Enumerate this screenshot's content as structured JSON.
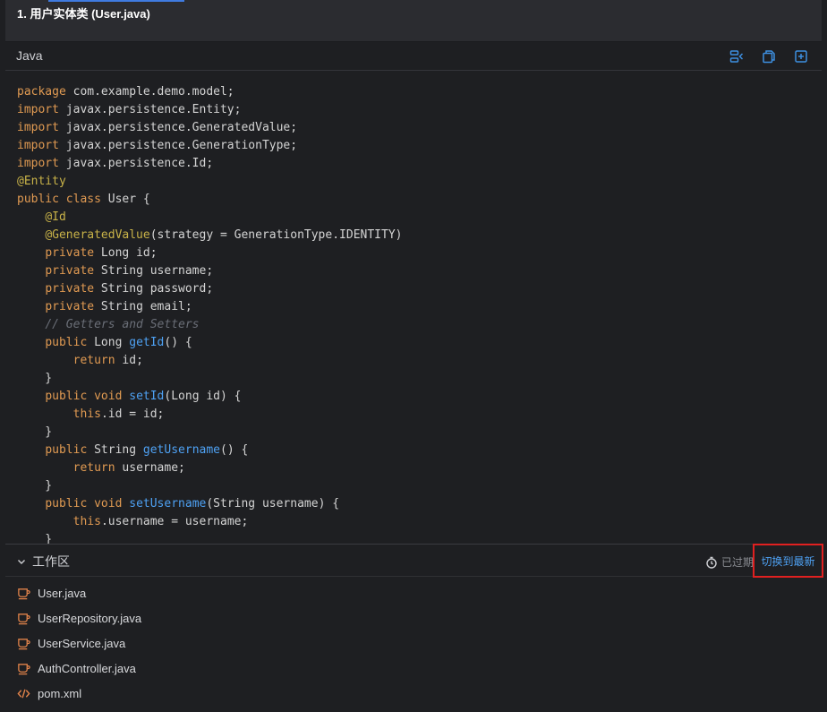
{
  "heading": {
    "text": "1. 用户实体类 (User.java)"
  },
  "code_block": {
    "language": "Java",
    "actions": [
      {
        "icon": "wrap-toggle-icon"
      },
      {
        "icon": "copy-icon"
      },
      {
        "icon": "expand-icon"
      }
    ],
    "lines": [
      [
        {
          "t": "package",
          "c": "kw"
        },
        {
          "t": " com.example.demo.model;"
        }
      ],
      [
        {
          "t": "import",
          "c": "kw"
        },
        {
          "t": " javax.persistence.Entity;"
        }
      ],
      [
        {
          "t": "import",
          "c": "kw"
        },
        {
          "t": " javax.persistence.GeneratedValue;"
        }
      ],
      [
        {
          "t": "import",
          "c": "kw"
        },
        {
          "t": " javax.persistence.GenerationType;"
        }
      ],
      [
        {
          "t": "import",
          "c": "kw"
        },
        {
          "t": " javax.persistence.Id;"
        }
      ],
      [
        {
          "t": "@Entity",
          "c": "an"
        }
      ],
      [
        {
          "t": "public",
          "c": "kw"
        },
        {
          "t": " "
        },
        {
          "t": "class",
          "c": "kw"
        },
        {
          "t": " User {"
        }
      ],
      [
        {
          "t": "    "
        },
        {
          "t": "@Id",
          "c": "an"
        }
      ],
      [
        {
          "t": "    "
        },
        {
          "t": "@GeneratedValue",
          "c": "an"
        },
        {
          "t": "(strategy = GenerationType.IDENTITY)"
        }
      ],
      [
        {
          "t": "    "
        },
        {
          "t": "private",
          "c": "kw"
        },
        {
          "t": " Long id;"
        }
      ],
      [
        {
          "t": "    "
        },
        {
          "t": "private",
          "c": "kw"
        },
        {
          "t": " String username;"
        }
      ],
      [
        {
          "t": "    "
        },
        {
          "t": "private",
          "c": "kw"
        },
        {
          "t": " String password;"
        }
      ],
      [
        {
          "t": "    "
        },
        {
          "t": "private",
          "c": "kw"
        },
        {
          "t": " String email;"
        }
      ],
      [
        {
          "t": "    "
        },
        {
          "t": "// Getters and Setters",
          "c": "cm"
        }
      ],
      [
        {
          "t": "    "
        },
        {
          "t": "public",
          "c": "kw"
        },
        {
          "t": " Long "
        },
        {
          "t": "getId",
          "c": "fn"
        },
        {
          "t": "() {"
        }
      ],
      [
        {
          "t": "        "
        },
        {
          "t": "return",
          "c": "kw"
        },
        {
          "t": " id;"
        }
      ],
      [
        {
          "t": "    }"
        }
      ],
      [
        {
          "t": "    "
        },
        {
          "t": "public",
          "c": "kw"
        },
        {
          "t": " "
        },
        {
          "t": "void",
          "c": "kw"
        },
        {
          "t": " "
        },
        {
          "t": "setId",
          "c": "fn"
        },
        {
          "t": "(Long id) {"
        }
      ],
      [
        {
          "t": "        "
        },
        {
          "t": "this",
          "c": "th"
        },
        {
          "t": ".id = id;"
        }
      ],
      [
        {
          "t": "    }"
        }
      ],
      [
        {
          "t": "    "
        },
        {
          "t": "public",
          "c": "kw"
        },
        {
          "t": " String "
        },
        {
          "t": "getUsername",
          "c": "fn"
        },
        {
          "t": "() {"
        }
      ],
      [
        {
          "t": "        "
        },
        {
          "t": "return",
          "c": "kw"
        },
        {
          "t": " username;"
        }
      ],
      [
        {
          "t": "    }"
        }
      ],
      [
        {
          "t": "    "
        },
        {
          "t": "public",
          "c": "kw"
        },
        {
          "t": " "
        },
        {
          "t": "void",
          "c": "kw"
        },
        {
          "t": " "
        },
        {
          "t": "setUsername",
          "c": "fn"
        },
        {
          "t": "(String username) {"
        }
      ],
      [
        {
          "t": "        "
        },
        {
          "t": "this",
          "c": "th"
        },
        {
          "t": ".username = username;"
        }
      ],
      [
        {
          "t": "    }"
        }
      ]
    ]
  },
  "workspace": {
    "title": "工作区",
    "status": "已过期",
    "switch_label": "切换到最新",
    "files": [
      {
        "name": "User.java",
        "icon": "java-file-icon"
      },
      {
        "name": "UserRepository.java",
        "icon": "java-file-icon"
      },
      {
        "name": "UserService.java",
        "icon": "java-file-icon"
      },
      {
        "name": "AuthController.java",
        "icon": "java-file-icon"
      },
      {
        "name": "pom.xml",
        "icon": "xml-file-icon"
      }
    ]
  },
  "colors": {
    "background": "#1e1f22",
    "keyword": "#e09a52",
    "annotation": "#c8b248",
    "method": "#4ea1f3",
    "comment": "#6a6e77",
    "link": "#4ea1f3",
    "highlight_border": "#e02020"
  }
}
